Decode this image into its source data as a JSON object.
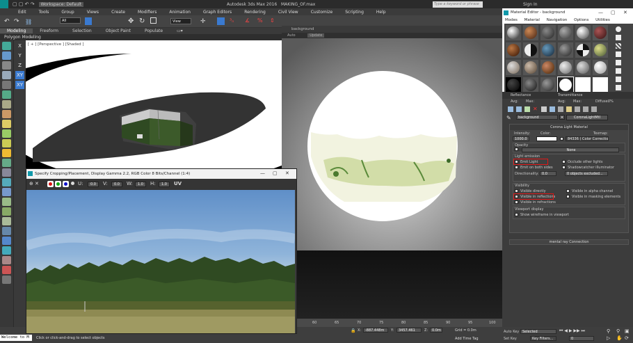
{
  "titlebar": {
    "workspace_label": "Workspace: Default",
    "app": "Autodesk 3ds Max 2016",
    "file": "MAKING_OF.max",
    "search_placeholder": "Type a keyword or phrase",
    "signin": "Sign In"
  },
  "menu": [
    "Edit",
    "Tools",
    "Group",
    "Views",
    "Create",
    "Modifiers",
    "Animation",
    "Graph Editors",
    "Rendering",
    "Civil View",
    "Customize",
    "Scripting",
    "Help"
  ],
  "toolbar": {
    "selection_filter": "All",
    "ref_coord": "View"
  },
  "ribbon": {
    "tabs": [
      "Modeling",
      "Freeform",
      "Selection",
      "Object Paint",
      "Populate"
    ],
    "panel_label": "Polygon Modeling"
  },
  "axes": [
    "X",
    "Y",
    "Z",
    "XY",
    "XY"
  ],
  "viewport1": {
    "label": "[ + ] [Perspective ] [Shaded ]"
  },
  "viewport2": {
    "title": "background",
    "mode": "Auto",
    "alt": "Update"
  },
  "crop_window": {
    "title": "Specify Cropping/Placement, Display Gamma 2.2, RGB Color 8 Bits/Channel (1:4)",
    "u_label": "U:",
    "u": "0.0",
    "v_label": "V:",
    "v": "0.0",
    "w_label": "W:",
    "w": "1.0",
    "h_label": "H:",
    "h": "1.0",
    "uv": "UV"
  },
  "timeline": {
    "ticks": [
      "60",
      "65",
      "70",
      "75",
      "80",
      "85",
      "90",
      "95",
      "100"
    ]
  },
  "status": {
    "welcome": "Welcome to M",
    "prompt": "Click or click-and-drag to select objects",
    "x_label": "X:",
    "x": "-887.448m",
    "y_label": "Y:",
    "y": "3457.461",
    "z_label": "Z:",
    "z": "0.0m",
    "grid": "Grid = 0.0m",
    "add_time_tag": "Add Time Tag"
  },
  "anim": {
    "autokey": "Auto Key",
    "setkey": "Set Key",
    "selected": "Selected",
    "keyfilters": "Key Filters...",
    "frame": "0"
  },
  "material_editor": {
    "title": "Material Editor - background",
    "menu": [
      "Modes",
      "Material",
      "Navigation",
      "Options",
      "Utilities"
    ],
    "reflectance_label": "Reflectance",
    "transmittance_label": "Transmittance",
    "avg_label": "Avg:",
    "max_label": "Max:",
    "diffuse_label": "Diffuse:",
    "diffuse": "0%",
    "material_name": "background",
    "material_type": "CoronaLightMtl",
    "rollout_title": "Corona Light Material",
    "intensity_label": "Intensity:",
    "intensity": "1000.0",
    "color_label": "Color:",
    "texmap_label": "Texmap:",
    "texmap_value": "84336 ( Color Correction )",
    "opacity_label": "Opacity",
    "opacity_map": "None",
    "light_emission_label": "Light emission",
    "emit_light": "Emit Light",
    "emit_both": "Emit on both sides",
    "include_lights": "Occlude other lights",
    "shadowcatcher": "Shadowcatcher illuminator",
    "directionality_label": "Directionality:",
    "directionality": "0.0",
    "excluded": "0 objects excluded...",
    "visibility_label": "Visibility",
    "visible_directly": "Visible directly",
    "visible_reflections": "Visible in reflections",
    "visible_refractions": "Visible in refractions",
    "visible_alpha": "Visible in alpha channel",
    "visible_masking": "Visible in masking elements",
    "viewport_display_label": "Viewport display",
    "show_wireframe": "Show wireframe in viewport",
    "mental_ray": "mental ray Connection"
  },
  "colors": {
    "accent": "#3a7ad0",
    "highlight": "#e01818"
  }
}
